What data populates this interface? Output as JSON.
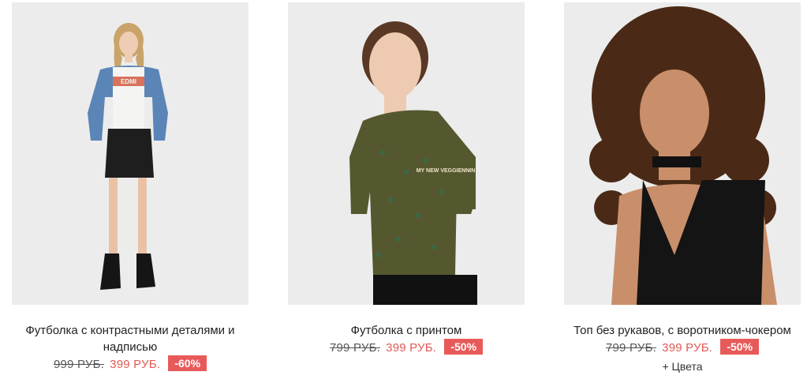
{
  "products": [
    {
      "title": "Футболка с контрастными деталями и надписью",
      "old_price": "999 РУБ.",
      "new_price": "399 РУБ.",
      "discount": "-60%",
      "tee_print": "EDMI",
      "colors_link": ""
    },
    {
      "title": "Футболка с принтом",
      "old_price": "799 РУБ.",
      "new_price": "399 РУБ.",
      "discount": "-50%",
      "tee_print": "MY NEW VEGGIENNIN",
      "colors_link": ""
    },
    {
      "title": "Топ без рукавов, с воротником-чокером",
      "old_price": "799 РУБ.",
      "new_price": "399 РУБ.",
      "discount": "-50%",
      "tee_print": "",
      "colors_link": "+ Цвета"
    }
  ],
  "colors": {
    "sale_price": "#e05a55",
    "badge_bg": "#e85a5a",
    "photo_bg": "#ececec"
  }
}
